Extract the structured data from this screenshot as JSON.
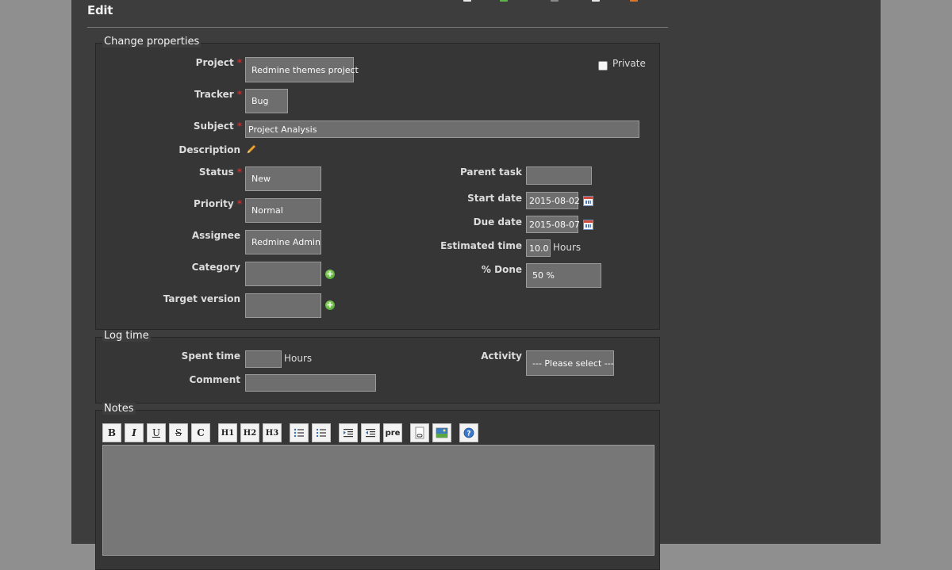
{
  "page": {
    "title": "Edit"
  },
  "properties": {
    "legend": "Change properties",
    "project": {
      "label": "Project",
      "value": "Redmine themes project"
    },
    "private_label": "Private",
    "tracker": {
      "label": "Tracker",
      "value": "Bug"
    },
    "subject": {
      "label": "Subject",
      "value": "Project Analysis"
    },
    "description": {
      "label": "Description"
    },
    "status": {
      "label": "Status",
      "value": "New"
    },
    "priority": {
      "label": "Priority",
      "value": "Normal"
    },
    "assignee": {
      "label": "Assignee",
      "value": "Redmine Admin"
    },
    "category": {
      "label": "Category",
      "value": ""
    },
    "target_version": {
      "label": "Target version",
      "value": ""
    },
    "parent_task": {
      "label": "Parent task",
      "value": ""
    },
    "start_date": {
      "label": "Start date",
      "value": "2015-08-02"
    },
    "due_date": {
      "label": "Due date",
      "value": "2015-08-07"
    },
    "estimated_time": {
      "label": "Estimated time",
      "value": "10.0",
      "unit": "Hours"
    },
    "done": {
      "label": "% Done",
      "value": "50 %"
    },
    "required_marker": "*"
  },
  "log_time": {
    "legend": "Log time",
    "spent_time": {
      "label": "Spent time",
      "value": "",
      "unit": "Hours"
    },
    "comment": {
      "label": "Comment",
      "value": ""
    },
    "activity": {
      "label": "Activity",
      "value": "--- Please select ---"
    }
  },
  "notes": {
    "legend": "Notes",
    "toolbar": {
      "bold": "B",
      "italic": "I",
      "underline": "U",
      "strike": "S",
      "code": "C",
      "h1": "H1",
      "h2": "H2",
      "h3": "H3",
      "pre": "pre"
    },
    "value": ""
  },
  "colors": {
    "required": "#d02a2a",
    "background": "#3d3d3d",
    "field": "#6e6e6e"
  }
}
